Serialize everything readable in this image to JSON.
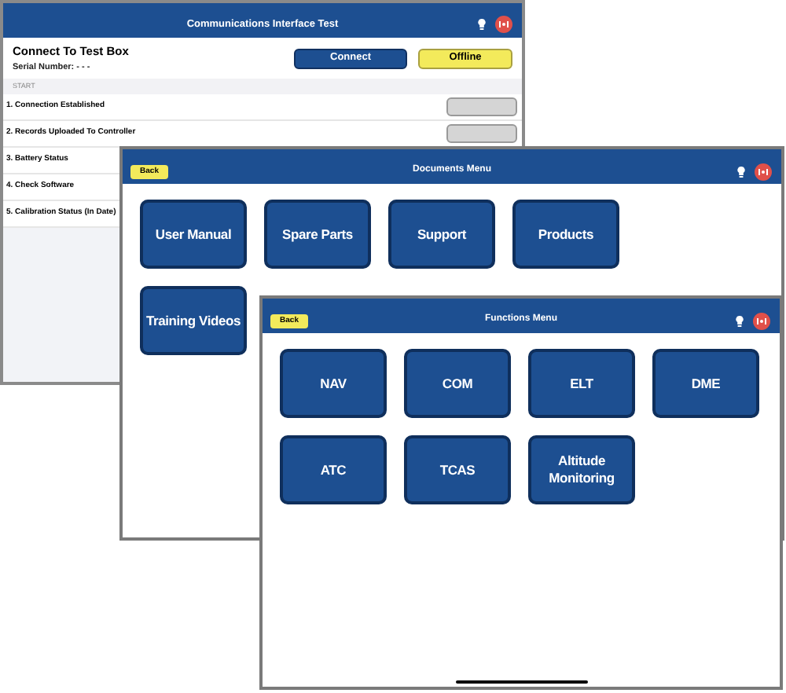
{
  "windows": [
    {
      "kind": "test",
      "title": "Communications Interface Test",
      "heading": "Connect To Test Box",
      "serial": "Serial Number: - - -",
      "connect_button": "Connect",
      "status_button": "Offline",
      "section": "START",
      "steps": [
        {
          "label": "1. Connection Established",
          "kind": "box"
        },
        {
          "label": "2. Records Uploaded To Controller",
          "kind": "box"
        },
        {
          "label": "3. Battery Status",
          "kind": "text"
        },
        {
          "label": "4. Check Software",
          "kind": "text"
        },
        {
          "label": "5. Calibration Status (In Date)",
          "kind": "text"
        }
      ]
    },
    {
      "kind": "menu",
      "title": "Documents Menu",
      "back": "Back",
      "items": [
        "User Manual",
        "Spare Parts",
        "Support",
        "Products",
        "Training Videos"
      ]
    },
    {
      "kind": "menu",
      "title": "Functions Menu",
      "back": "Back",
      "items": [
        "NAV",
        "COM",
        "ELT",
        "DME",
        "ATC",
        "TCAS",
        "Altitude Monitoring"
      ],
      "home_indicator": true
    }
  ]
}
